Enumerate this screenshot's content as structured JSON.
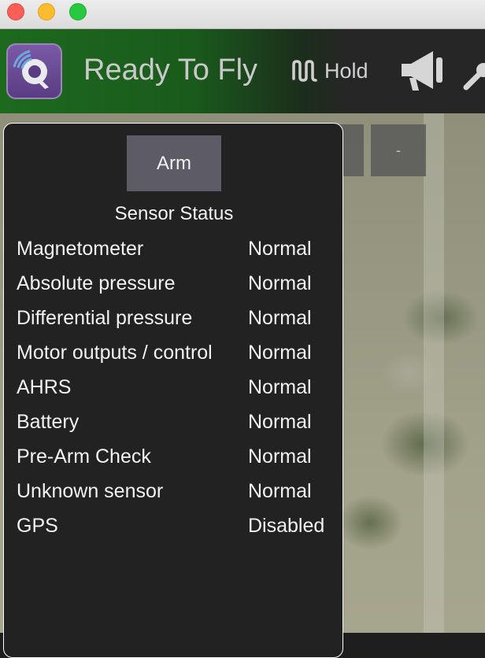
{
  "window": {
    "controls": [
      "close",
      "minimize",
      "maximize"
    ]
  },
  "toolbar": {
    "status": "Ready To Fly",
    "mode_label": "Hold",
    "icons": [
      "qgc-logo-icon",
      "hold-mode-icon",
      "megaphone-icon",
      "wrench-icon"
    ],
    "colors": {
      "gradient_start": "#1d6a1f",
      "gradient_end": "#262626"
    }
  },
  "map": {
    "zoom_out_label": "-"
  },
  "panel": {
    "arm_label": "Arm",
    "title": "Sensor Status",
    "sensors": [
      {
        "name": "Magnetometer",
        "status": "Normal"
      },
      {
        "name": "Absolute pressure",
        "status": "Normal"
      },
      {
        "name": "Differential pressure",
        "status": "Normal"
      },
      {
        "name": "Motor outputs / control",
        "status": "Normal"
      },
      {
        "name": "AHRS",
        "status": "Normal"
      },
      {
        "name": "Battery",
        "status": "Normal"
      },
      {
        "name": "Pre-Arm Check",
        "status": "Normal"
      },
      {
        "name": "Unknown sensor",
        "status": "Normal"
      },
      {
        "name": "GPS",
        "status": "Disabled"
      }
    ]
  }
}
